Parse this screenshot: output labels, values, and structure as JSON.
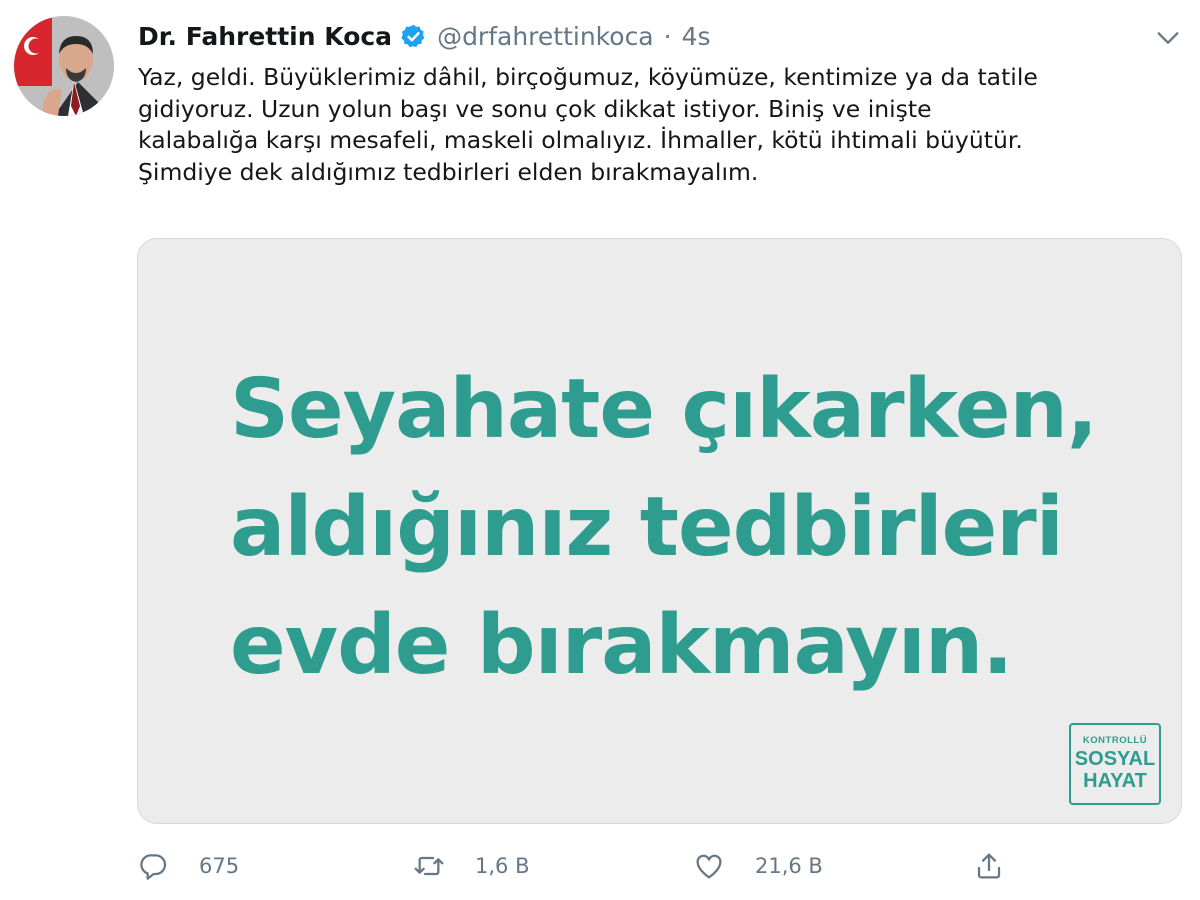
{
  "author": {
    "name": "Dr. Fahrettin Koca",
    "handle": "@drfahrettinkoca",
    "separator": "·",
    "timestamp": "4s",
    "verified": true
  },
  "tweet": {
    "lines": [
      "Yaz, geldi. Büyüklerimiz dâhil, birçoğumuz, köyümüze, kentimize ya da tatile",
      "gidiyoruz. Uzun yolun başı ve sonu çok dikkat istiyor. Biniş ve inişte",
      "kalabalığa karşı mesafeli, maskeli olmalıyız. İhmaller, kötü ihtimali büyütür.",
      "Şimdiye dek aldığımız tedbirleri elden bırakmayalım."
    ]
  },
  "media": {
    "headline": [
      "Seyahate çıkarken,",
      "aldığınız tedbirleri",
      "evde bırakmayın."
    ],
    "badge": {
      "line1": "KONTROLLÜ",
      "line2": "SOSYAL",
      "line3": "HAYAT"
    },
    "accent_color": "#2e9c8e",
    "background_color": "#ececec"
  },
  "actions": {
    "reply": {
      "icon": "reply-icon",
      "count": "675"
    },
    "retweet": {
      "icon": "retweet-icon",
      "count": "1,6 B"
    },
    "like": {
      "icon": "heart-icon",
      "count": "21,6 B"
    },
    "share": {
      "icon": "share-icon"
    }
  },
  "colors": {
    "text_primary": "#14171a",
    "text_secondary": "#657786",
    "verified_blue": "#1da1f2"
  }
}
